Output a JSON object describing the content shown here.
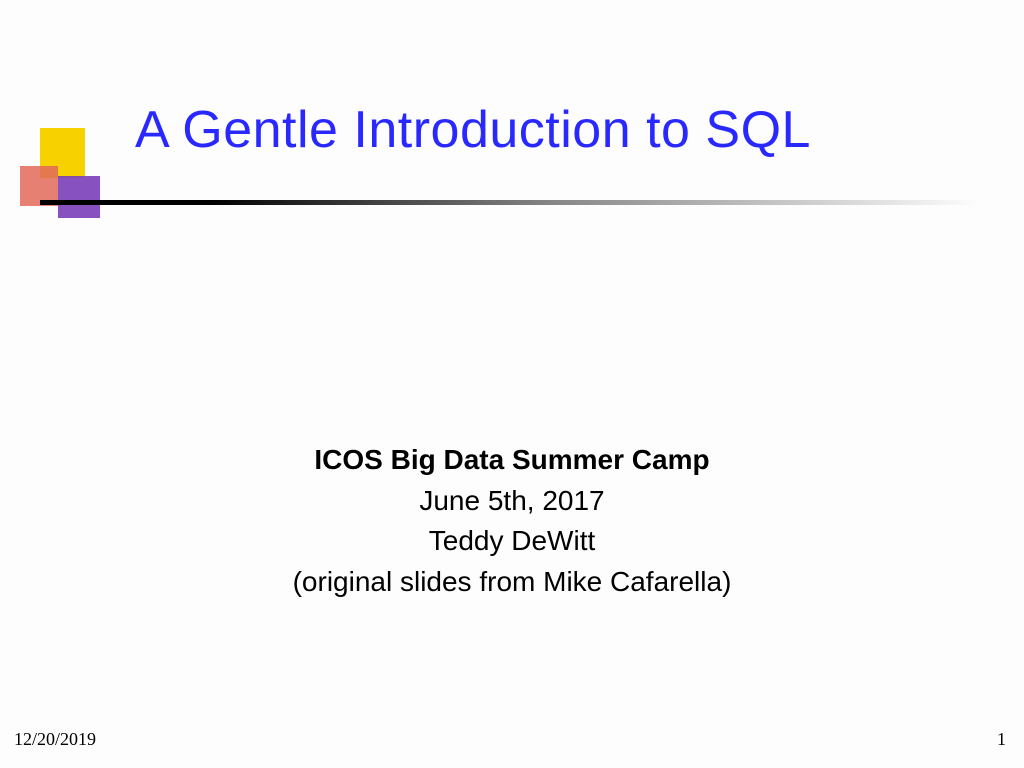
{
  "title": "A Gentle Introduction to SQL",
  "body": {
    "heading": "ICOS Big Data Summer Camp",
    "date": "June 5th, 2017",
    "author": "Teddy DeWitt",
    "credit": "(original slides from Mike Cafarella)"
  },
  "footer": {
    "date": "12/20/2019",
    "page": "1"
  },
  "colors": {
    "title": "#2929ff",
    "accent_yellow": "#f7d100",
    "accent_red": "#e06a5a",
    "accent_purple": "#7a3fb9"
  }
}
